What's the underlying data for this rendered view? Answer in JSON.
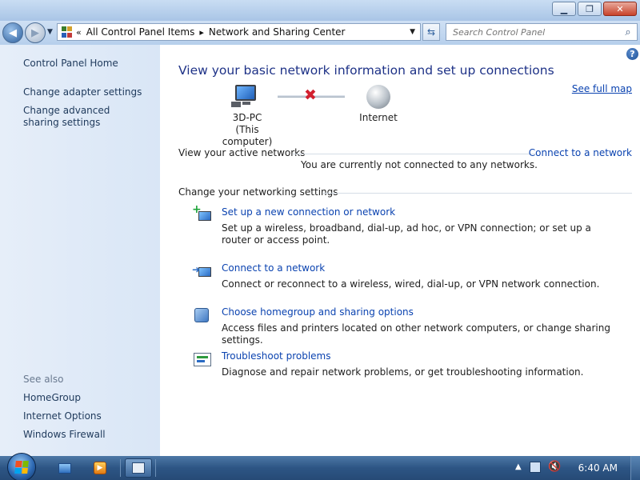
{
  "window": {
    "controls": {
      "minimize": "▁",
      "maximize": "❐",
      "close": "✕"
    }
  },
  "address": {
    "overflow": "«",
    "crumbs": [
      "All Control Panel Items",
      "Network and Sharing Center"
    ],
    "separator": "▸",
    "search_placeholder": "Search Control Panel"
  },
  "sidebar": {
    "home": "Control Panel Home",
    "items": [
      "Change adapter settings",
      "Change advanced sharing settings"
    ],
    "see_also_heading": "See also",
    "see_also": [
      "HomeGroup",
      "Internet Options",
      "Windows Firewall"
    ]
  },
  "main": {
    "title": "View your basic network information and set up connections",
    "see_full_map": "See full map",
    "computer_label_line1": "3D-PC",
    "computer_label_line2": "(This computer)",
    "internet_label": "Internet",
    "active_networks_heading": "View your active networks",
    "connect_link": "Connect to a network",
    "not_connected": "You are currently not connected to any networks.",
    "settings_heading": "Change your networking settings",
    "tasks": [
      {
        "link": "Set up a new connection or network",
        "desc": "Set up a wireless, broadband, dial-up, ad hoc, or VPN connection; or set up a router or access point."
      },
      {
        "link": "Connect to a network",
        "desc": "Connect or reconnect to a wireless, wired, dial-up, or VPN network connection."
      },
      {
        "link": "Choose homegroup and sharing options",
        "desc": "Access files and printers located on other network computers, or change sharing settings."
      },
      {
        "link": "Troubleshoot problems",
        "desc": "Diagnose and repair network problems, or get troubleshooting information."
      }
    ]
  },
  "taskbar": {
    "clock": "6:40 AM"
  },
  "colors": {
    "link": "#0b43b0",
    "title": "#1e3287",
    "sidebar_link": "#1e395b"
  }
}
